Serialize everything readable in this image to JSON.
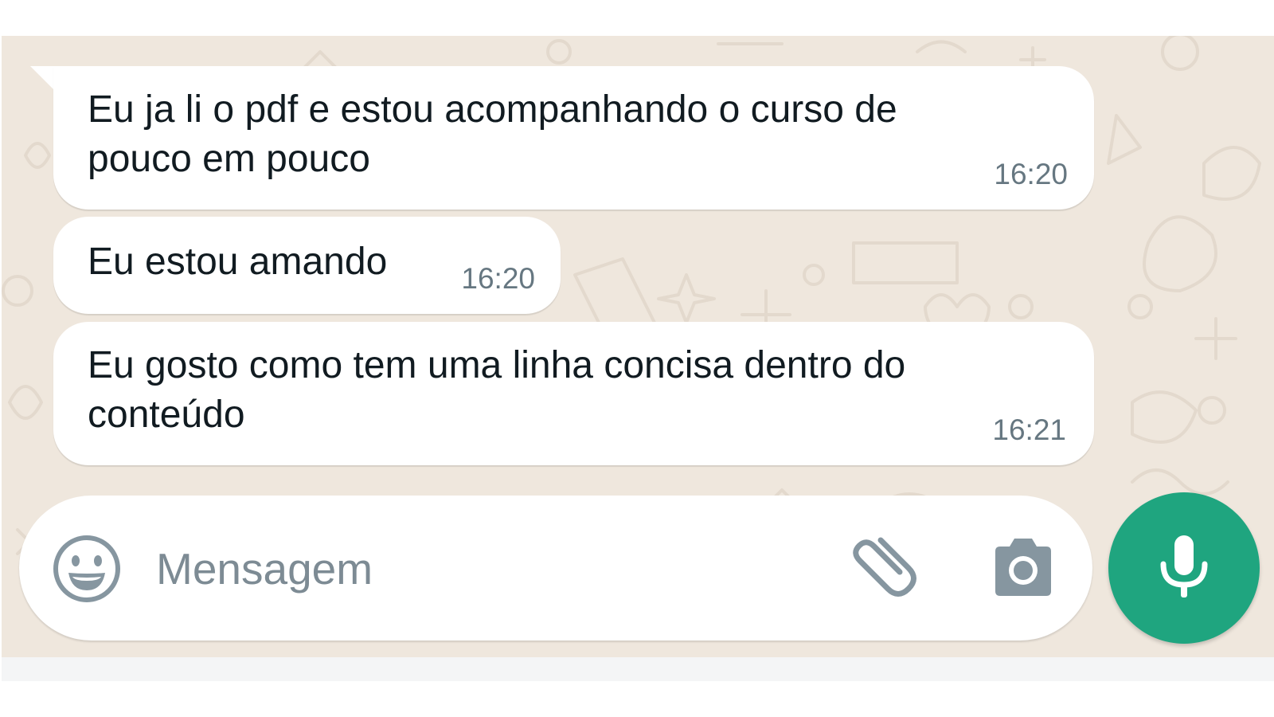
{
  "colors": {
    "chat_background": "#efe7dd",
    "bubble": "#ffffff",
    "message_text": "#111b21",
    "timestamp": "#667781",
    "icon_gray": "#8696a0",
    "mic_button": "#1fa57f"
  },
  "messages": [
    {
      "text": "Eu ja li o pdf e estou acompanhando o curso de\npouco em pouco",
      "time": "16:20"
    },
    {
      "text": "Eu estou amando",
      "time": "16:20"
    },
    {
      "text": "Eu gosto como tem uma linha concisa dentro do\nconteúdo",
      "time": "16:21"
    }
  ],
  "composer": {
    "placeholder": "Mensagem",
    "value": "",
    "icons": [
      "emoji-icon",
      "paperclip-icon",
      "camera-icon",
      "microphone-icon"
    ]
  }
}
